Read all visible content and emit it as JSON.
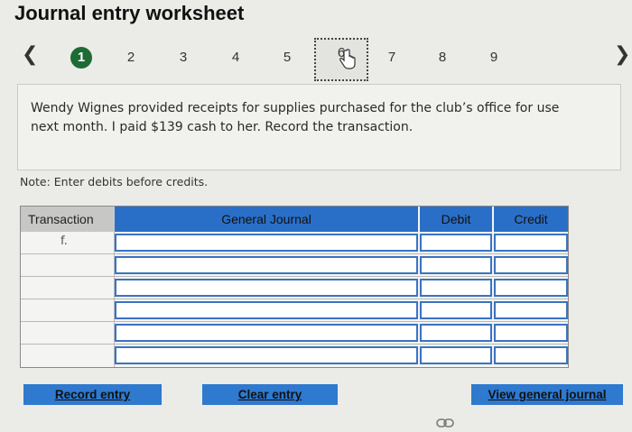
{
  "page": {
    "title": "Journal entry worksheet"
  },
  "nav": {
    "prev_icon": "chevron-left-icon",
    "next_icon": "chevron-right-icon",
    "steps": [
      "1",
      "2",
      "3",
      "4",
      "5",
      "6",
      "7",
      "8",
      "9"
    ],
    "active_step": "1",
    "current_step": "6"
  },
  "question": {
    "text": "Wendy Wignes provided receipts for supplies purchased for the club’s office for use next month. I paid $139 cash to her. Record the transaction."
  },
  "note": "Note: Enter debits before credits.",
  "table": {
    "headers": {
      "transaction": "Transaction",
      "journal": "General Journal",
      "debit": "Debit",
      "credit": "Credit"
    },
    "rows": [
      {
        "transaction": "f.",
        "journal": "",
        "debit": "",
        "credit": ""
      },
      {
        "transaction": "",
        "journal": "",
        "debit": "",
        "credit": ""
      },
      {
        "transaction": "",
        "journal": "",
        "debit": "",
        "credit": ""
      },
      {
        "transaction": "",
        "journal": "",
        "debit": "",
        "credit": ""
      },
      {
        "transaction": "",
        "journal": "",
        "debit": "",
        "credit": ""
      },
      {
        "transaction": "",
        "journal": "",
        "debit": "",
        "credit": ""
      }
    ]
  },
  "buttons": {
    "record": "Record entry",
    "clear": "Clear entry",
    "view": "View general journal"
  },
  "colors": {
    "accent_blue": "#2f79cf",
    "active_step_green": "#1d6b35"
  }
}
